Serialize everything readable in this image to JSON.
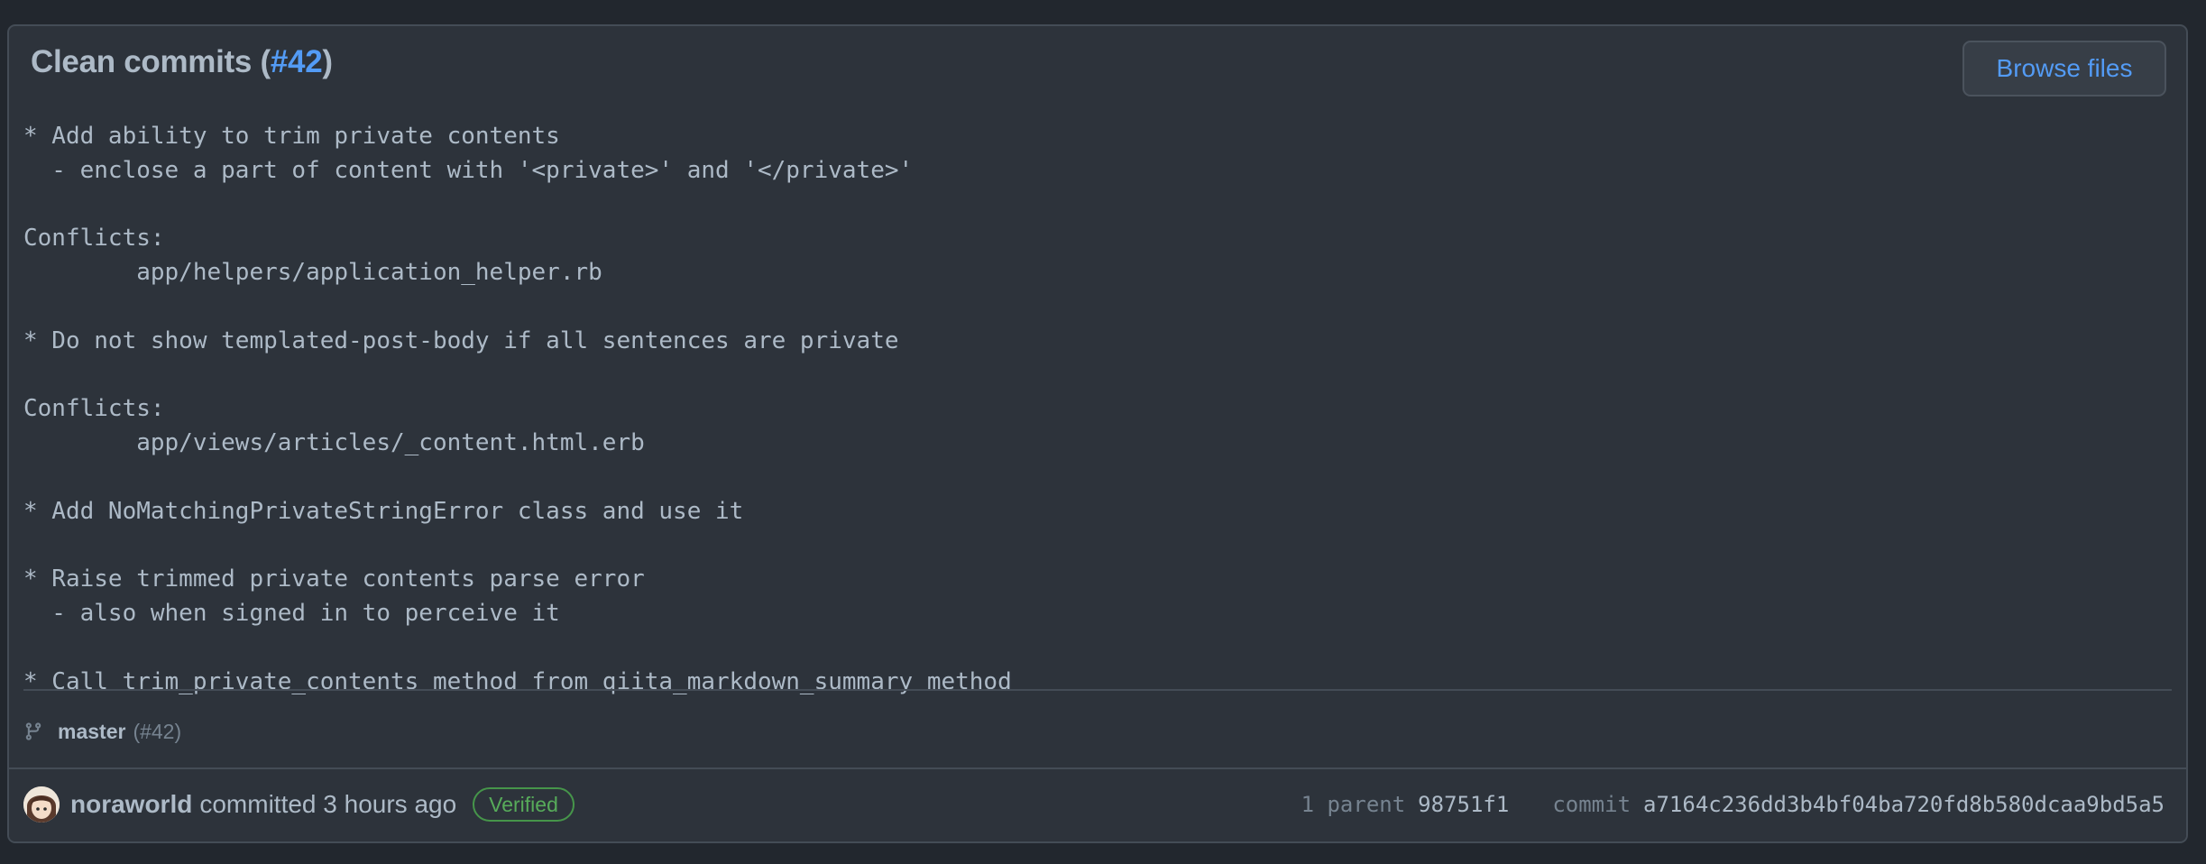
{
  "commit": {
    "title_prefix": "Clean commits (",
    "pr_ref": "#42",
    "title_suffix": ")",
    "browse_label": "Browse files",
    "message": "* Add ability to trim private contents\n  - enclose a part of content with '<private>' and '</private>'\n\nConflicts:\n        app/helpers/application_helper.rb\n\n* Do not show templated-post-body if all sentences are private\n\nConflicts:\n        app/views/articles/_content.html.erb\n\n* Add NoMatchingPrivateStringError class and use it\n\n* Raise trimmed private contents parse error\n  - also when signed in to perceive it\n\n* Call trim_private_contents method from qiita_markdown_summary method"
  },
  "branch": {
    "icon": "git-branch-icon",
    "name": "master",
    "pr": "(#42)"
  },
  "footer": {
    "author": "noraworld",
    "committed_text": "committed 3 hours ago",
    "verified_label": "Verified",
    "parent_label": "1 parent",
    "parent_sha": "98751f1",
    "commit_label": "commit",
    "commit_sha": "a7164c236dd3b4bf04ba720fd8b580dcaa9bd5a5"
  },
  "colors": {
    "background": "#22272e",
    "panel": "#2d333b",
    "border": "#444c56",
    "link": "#539bf5",
    "verified": "#57ab5a",
    "text": "#adbac7",
    "muted": "#768390"
  }
}
